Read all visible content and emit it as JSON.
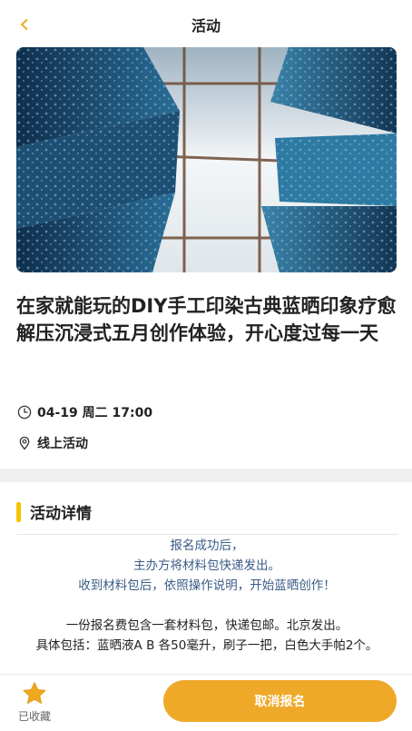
{
  "header": {
    "title": "活动",
    "back_icon": "chevron-left-icon"
  },
  "event": {
    "title": "在家就能玩的DIY手工印染古典蓝晒印象疗愈解压沉浸式五月创作体验，开心度过每一天",
    "time": "04-19 周二 17:00",
    "location": "线上活动"
  },
  "details": {
    "heading": "活动详情",
    "blue_lines": [
      "报名成功后，",
      "主办方将材料包快递发出。",
      "收到材料包后，依照操作说明，开始蓝晒创作！"
    ],
    "dark_lines": [
      "一份报名费包含一套材料包，快递包邮。北京发出。",
      "具体包括：蓝晒液A B 各50毫升，刷子一把，白色大手帕2个。"
    ]
  },
  "footer": {
    "favorite_label": "已收藏",
    "cancel_label": "取消报名"
  },
  "colors": {
    "accent": "#eea928",
    "section_bar": "#f5c400",
    "link_blue": "#3a5b86",
    "star": "#f0a81e"
  }
}
